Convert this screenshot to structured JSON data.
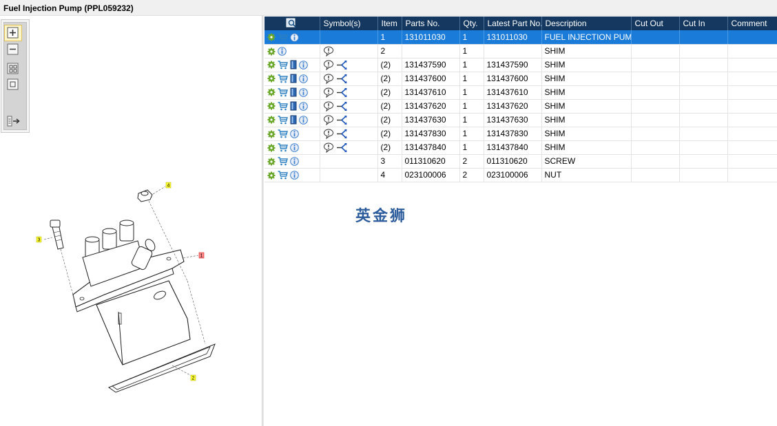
{
  "window": {
    "title": "Fuel Injection Pump (PPL059232)"
  },
  "toolbar": {
    "buttons": [
      {
        "name": "zoom-in",
        "icon": "zoom-in-icon"
      },
      {
        "name": "zoom-out",
        "icon": "zoom-out-icon"
      },
      {
        "name": "fit-all",
        "icon": "fit-all-icon"
      },
      {
        "name": "fit-frame",
        "icon": "fit-frame-icon"
      },
      {
        "name": "list-navigate",
        "icon": "list-arrow-icon"
      }
    ]
  },
  "diagram": {
    "callouts": [
      "1",
      "2",
      "3",
      "4"
    ]
  },
  "table": {
    "headers": [
      "",
      "Symbol(s)",
      "Item",
      "Parts No.",
      "Qty.",
      "Latest Part No.",
      "Description",
      "Cut Out",
      "Cut In",
      "Comment"
    ],
    "rows": [
      {
        "icons": [
          "gear",
          "cart",
          "info"
        ],
        "symbols": [],
        "item": "1",
        "part_no": "131011030",
        "qty": "1",
        "latest": "131011030",
        "description": "FUEL INJECTION PUMP",
        "cut_out": "",
        "cut_in": "",
        "comment": "",
        "selected": true
      },
      {
        "icons": [
          "gear",
          "info"
        ],
        "symbols": [
          "balloon"
        ],
        "item": "2",
        "part_no": "",
        "qty": "1",
        "latest": "",
        "description": "SHIM",
        "cut_out": "",
        "cut_in": "",
        "comment": ""
      },
      {
        "icons": [
          "gear",
          "cart",
          "book",
          "info"
        ],
        "symbols": [
          "balloon",
          "branch"
        ],
        "item": "(2)",
        "part_no": "131437590",
        "qty": "1",
        "latest": "131437590",
        "description": "SHIM",
        "cut_out": "",
        "cut_in": "",
        "comment": ""
      },
      {
        "icons": [
          "gear",
          "cart",
          "book",
          "info"
        ],
        "symbols": [
          "balloon",
          "branch"
        ],
        "item": "(2)",
        "part_no": "131437600",
        "qty": "1",
        "latest": "131437600",
        "description": "SHIM",
        "cut_out": "",
        "cut_in": "",
        "comment": ""
      },
      {
        "icons": [
          "gear",
          "cart",
          "book",
          "info"
        ],
        "symbols": [
          "balloon",
          "branch"
        ],
        "item": "(2)",
        "part_no": "131437610",
        "qty": "1",
        "latest": "131437610",
        "description": "SHIM",
        "cut_out": "",
        "cut_in": "",
        "comment": ""
      },
      {
        "icons": [
          "gear",
          "cart",
          "book",
          "info"
        ],
        "symbols": [
          "balloon",
          "branch"
        ],
        "item": "(2)",
        "part_no": "131437620",
        "qty": "1",
        "latest": "131437620",
        "description": "SHIM",
        "cut_out": "",
        "cut_in": "",
        "comment": ""
      },
      {
        "icons": [
          "gear",
          "cart",
          "book",
          "info"
        ],
        "symbols": [
          "balloon",
          "branch"
        ],
        "item": "(2)",
        "part_no": "131437630",
        "qty": "1",
        "latest": "131437630",
        "description": "SHIM",
        "cut_out": "",
        "cut_in": "",
        "comment": ""
      },
      {
        "icons": [
          "gear",
          "cart",
          "info"
        ],
        "symbols": [
          "balloon",
          "branch"
        ],
        "item": "(2)",
        "part_no": "131437830",
        "qty": "1",
        "latest": "131437830",
        "description": "SHIM",
        "cut_out": "",
        "cut_in": "",
        "comment": ""
      },
      {
        "icons": [
          "gear",
          "cart",
          "info"
        ],
        "symbols": [
          "balloon",
          "branch"
        ],
        "item": "(2)",
        "part_no": "131437840",
        "qty": "1",
        "latest": "131437840",
        "description": "SHIM",
        "cut_out": "",
        "cut_in": "",
        "comment": ""
      },
      {
        "icons": [
          "gear",
          "cart",
          "info"
        ],
        "symbols": [],
        "item": "3",
        "part_no": "011310620",
        "qty": "2",
        "latest": "011310620",
        "description": "SCREW",
        "cut_out": "",
        "cut_in": "",
        "comment": ""
      },
      {
        "icons": [
          "gear",
          "cart",
          "info"
        ],
        "symbols": [],
        "item": "4",
        "part_no": "023100006",
        "qty": "2",
        "latest": "023100006",
        "description": "NUT",
        "cut_out": "",
        "cut_in": "",
        "comment": ""
      }
    ]
  },
  "watermark": {
    "text": "英金狮"
  },
  "colors": {
    "header_bg": "#14385f",
    "selected_row": "#1a7bd8",
    "gear": "#6aa82a",
    "cart": "#2b7fc4",
    "info": "#3d7fcf"
  }
}
